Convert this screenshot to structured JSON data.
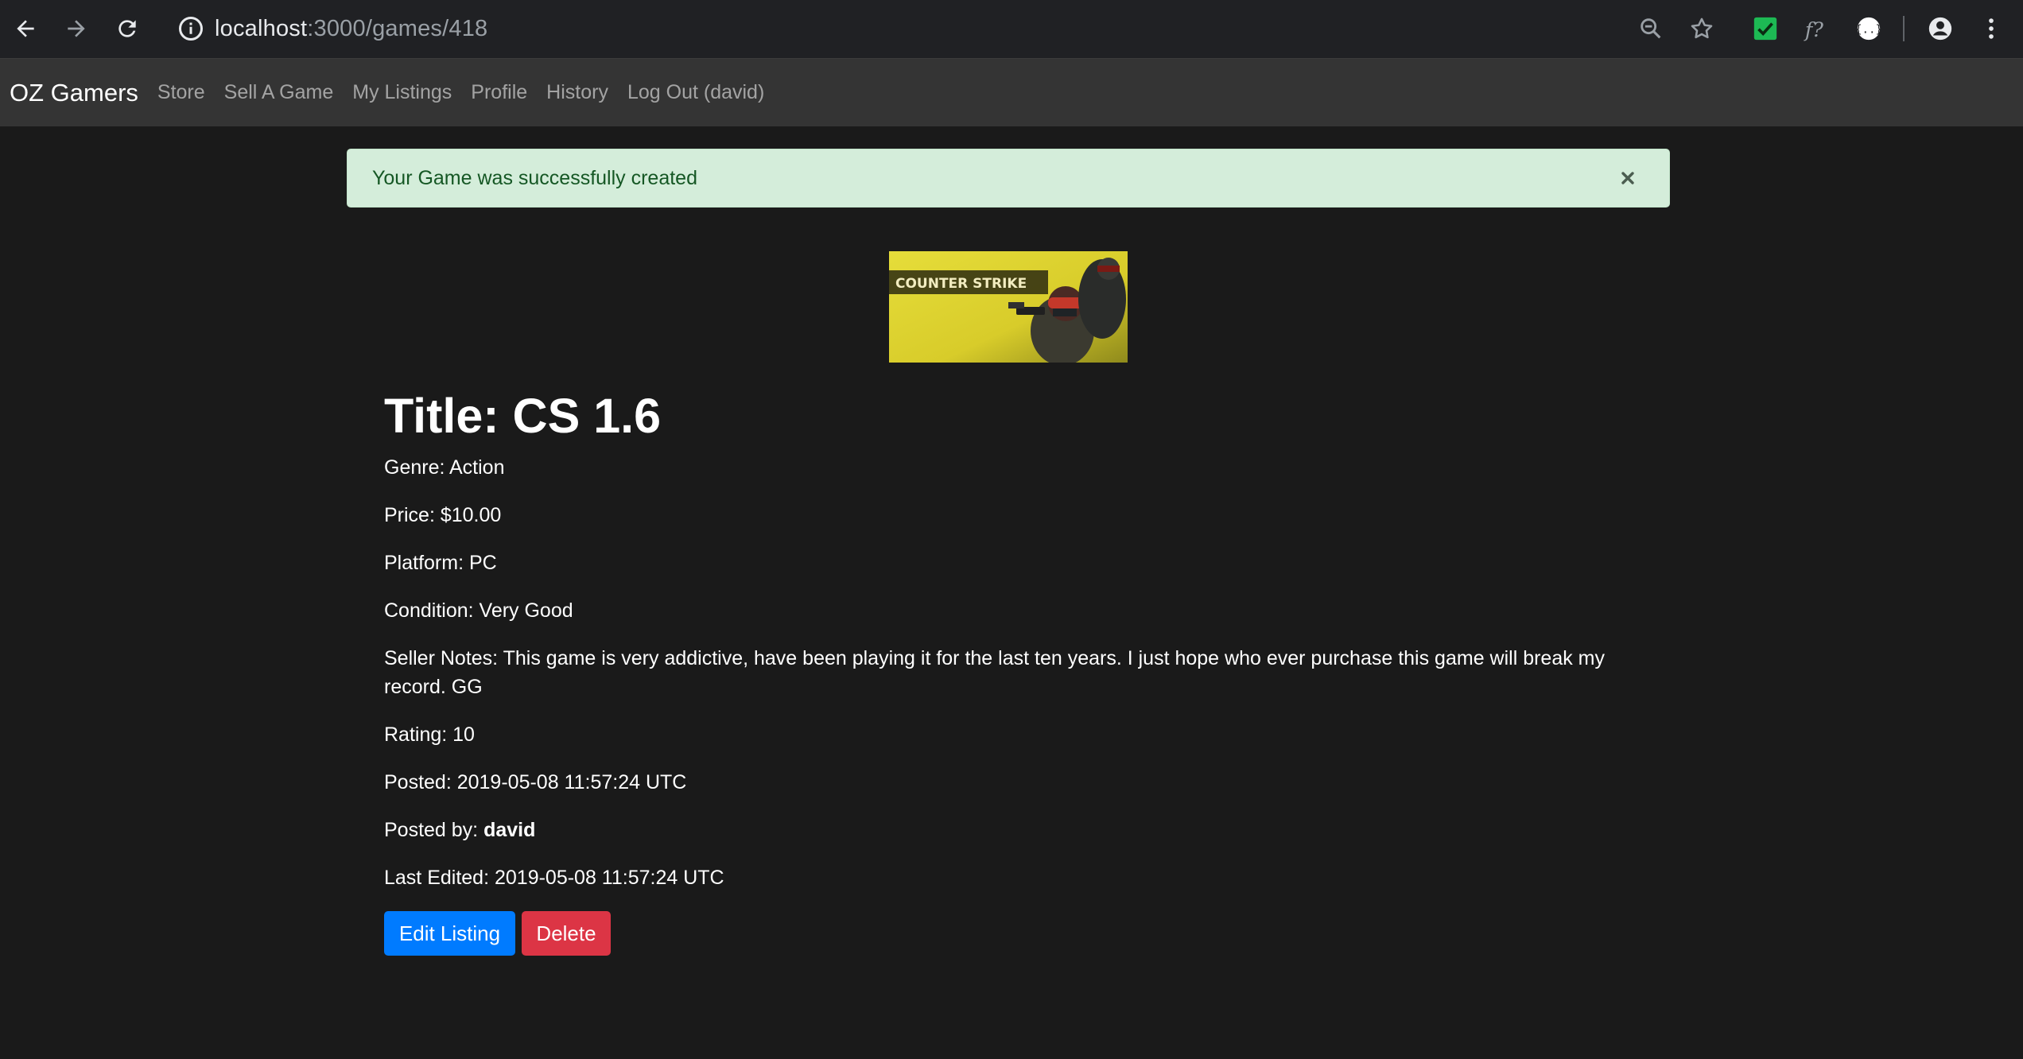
{
  "browser": {
    "url_host": "localhost",
    "url_rest": ":3000/games/418"
  },
  "navbar": {
    "brand": "OZ Gamers",
    "links": [
      "Store",
      "Sell A Game",
      "My Listings",
      "Profile",
      "History",
      "Log Out (david)"
    ]
  },
  "alert": {
    "message": "Your Game was successfully created",
    "close": "×"
  },
  "game": {
    "cover_logo_text": "COUNTER STRIKE",
    "title": "Title: CS 1.6",
    "genre": "Genre: Action",
    "price": "Price: $10.00",
    "platform": "Platform: PC",
    "condition": "Condition: Very Good",
    "seller_notes": "Seller Notes: This game is very addictive, have been playing it for the last ten years. I just hope who ever purchase this game will break my record. GG",
    "rating": "Rating: 10",
    "posted": "Posted: 2019-05-08 11:57:24 UTC",
    "posted_by_label": "Posted by: ",
    "posted_by_user": "david",
    "last_edited": "Last Edited: 2019-05-08 11:57:24 UTC"
  },
  "actions": {
    "edit": "Edit Listing",
    "delete": "Delete"
  },
  "colors": {
    "page_bg": "#1a1a1a",
    "navbar_bg": "#343434",
    "alert_bg": "#d4edda",
    "alert_text": "#155724",
    "primary": "#007bff",
    "danger": "#dc3545"
  }
}
